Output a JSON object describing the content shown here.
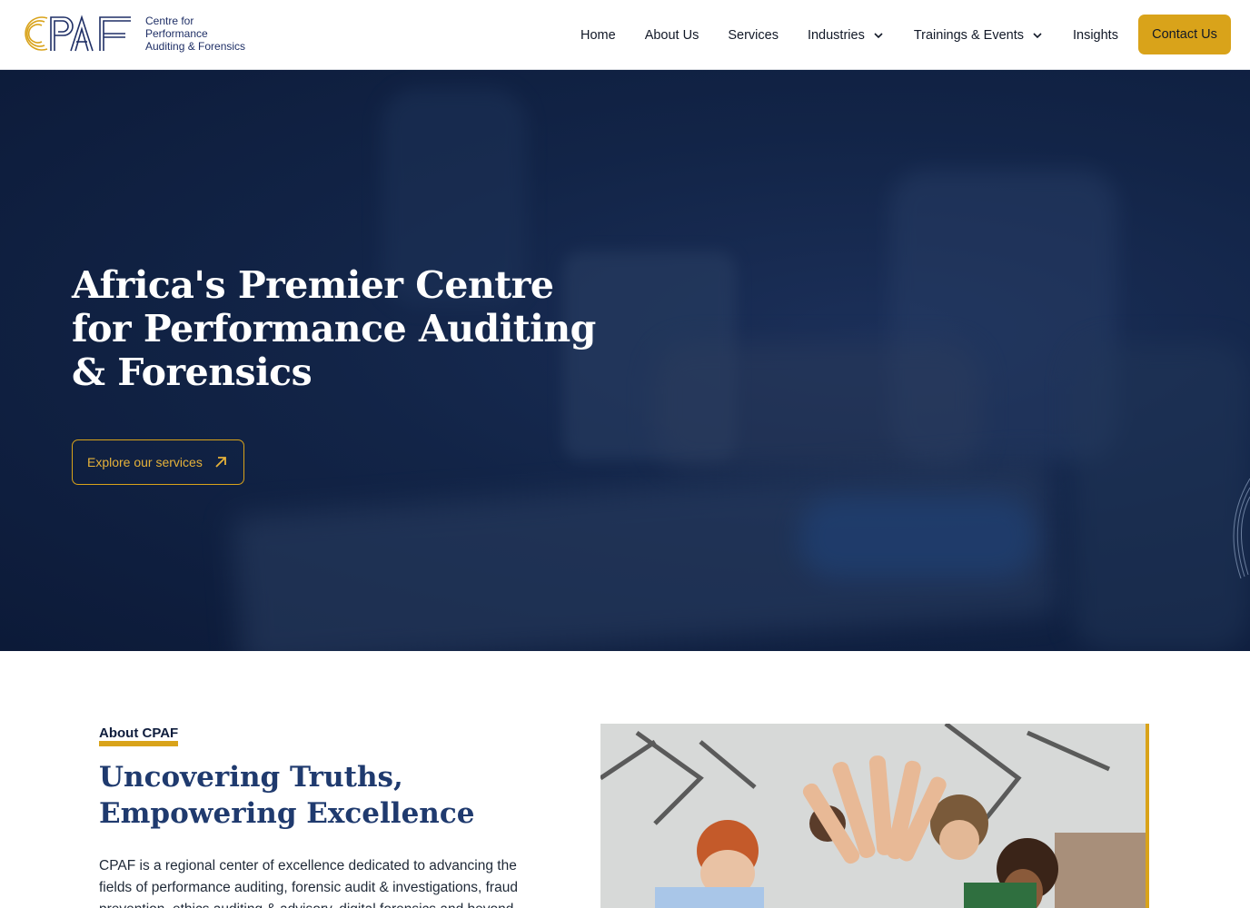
{
  "brand": {
    "logo_letters": "CPAF",
    "name_line1": "Centre for",
    "name_line2": "Performance",
    "name_line3": "Auditing & Forensics",
    "primary_color": "#1f2f66",
    "accent_color": "#d9a31a"
  },
  "nav": {
    "items": [
      {
        "label": "Home",
        "has_dropdown": false
      },
      {
        "label": "About Us",
        "has_dropdown": false
      },
      {
        "label": "Services",
        "has_dropdown": false
      },
      {
        "label": "Industries",
        "has_dropdown": true,
        "icon": "chevron-down-icon"
      },
      {
        "label": "Trainings & Events",
        "has_dropdown": true,
        "icon": "chevron-down-icon"
      },
      {
        "label": "Insights",
        "has_dropdown": false
      }
    ],
    "cta_label": "Contact Us"
  },
  "hero": {
    "title": "Africa's Premier Centre for Performance Auditing & Forensics",
    "button_label": "Explore our services",
    "button_icon": "arrow-up-right-icon"
  },
  "about": {
    "eyebrow": "About CPAF",
    "title": "Uncovering Truths, Empowering Excellence",
    "text": "CPAF is a regional center of excellence dedicated to advancing the fields of performance auditing, forensic audit & investigations, fraud prevention, ethics auditing & advisory, digital forensics and beyond."
  }
}
